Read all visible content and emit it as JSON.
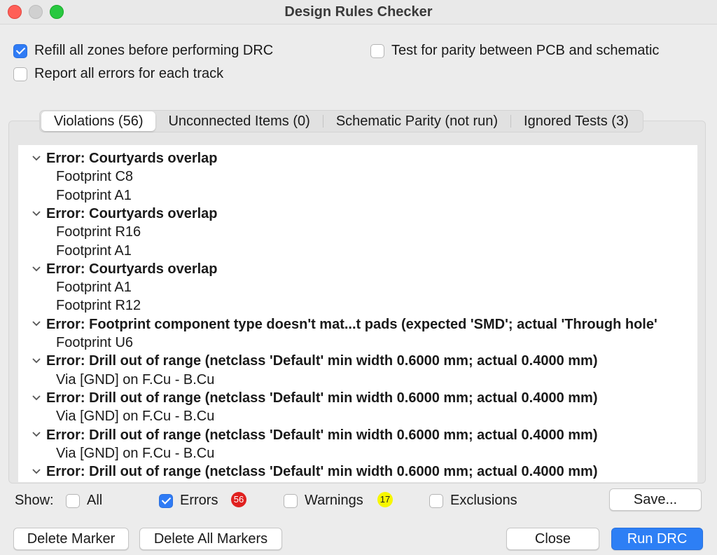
{
  "window": {
    "title": "Design Rules Checker"
  },
  "options": {
    "refill_zones": {
      "label": "Refill all zones before performing DRC",
      "checked": true
    },
    "report_all_errors": {
      "label": "Report all errors for each track",
      "checked": false
    },
    "test_parity": {
      "label": "Test for parity between PCB and schematic",
      "checked": false
    }
  },
  "tabs": [
    {
      "label": "Violations (56)",
      "active": true
    },
    {
      "label": "Unconnected Items (0)",
      "active": false
    },
    {
      "label": "Schematic Parity (not run)",
      "active": false
    },
    {
      "label": "Ignored Tests (3)",
      "active": false
    }
  ],
  "violations": [
    {
      "title": "Error: Courtyards overlap",
      "items": [
        "Footprint C8",
        "Footprint A1"
      ]
    },
    {
      "title": "Error: Courtyards overlap",
      "items": [
        "Footprint R16",
        "Footprint A1"
      ]
    },
    {
      "title": "Error: Courtyards overlap",
      "items": [
        "Footprint A1",
        "Footprint R12"
      ]
    },
    {
      "title": "Error: Footprint component type doesn't mat...t pads (expected 'SMD'; actual 'Through hole'",
      "items": [
        "Footprint U6"
      ]
    },
    {
      "title": "Error: Drill out of range (netclass 'Default' min width 0.6000 mm; actual 0.4000 mm)",
      "items": [
        "Via [GND] on F.Cu - B.Cu"
      ]
    },
    {
      "title": "Error: Drill out of range (netclass 'Default' min width 0.6000 mm; actual 0.4000 mm)",
      "items": [
        "Via [GND] on F.Cu - B.Cu"
      ]
    },
    {
      "title": "Error: Drill out of range (netclass 'Default' min width 0.6000 mm; actual 0.4000 mm)",
      "items": [
        "Via [GND] on F.Cu - B.Cu"
      ]
    },
    {
      "title": "Error: Drill out of range (netclass 'Default' min width 0.6000 mm; actual 0.4000 mm)",
      "items": []
    }
  ],
  "filter": {
    "show_label": "Show:",
    "all": {
      "label": "All",
      "checked": false
    },
    "errors": {
      "label": "Errors",
      "checked": true,
      "count": "56",
      "badge_color": "#e0201f"
    },
    "warnings": {
      "label": "Warnings",
      "checked": false,
      "count": "17",
      "badge_color": "#f7f700"
    },
    "exclusions": {
      "label": "Exclusions",
      "checked": false
    }
  },
  "buttons": {
    "save": "Save...",
    "delete_marker": "Delete Marker",
    "delete_all_markers": "Delete All Markers",
    "close": "Close",
    "run_drc": "Run DRC"
  },
  "colors": {
    "accent": "#2d7ff5"
  }
}
